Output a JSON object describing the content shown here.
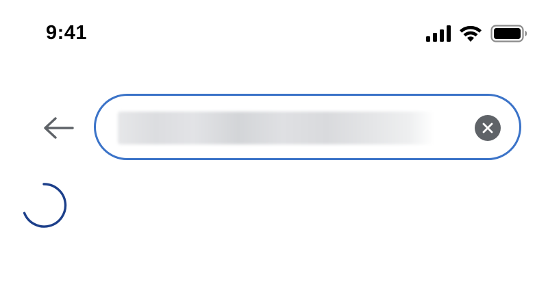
{
  "status_bar": {
    "time": "9:41",
    "icons": [
      "cellular-signal-icon",
      "wifi-icon",
      "battery-icon"
    ]
  },
  "search": {
    "value": "",
    "placeholder": "",
    "back_icon": "arrow-left-icon",
    "clear_icon": "clear-circle-icon",
    "query_obscured": true
  },
  "loading": {
    "icon": "loading-spinner-icon"
  },
  "colors": {
    "background": "#ffffff",
    "search_border": "#3b73c8",
    "clear_button": "#5f6368",
    "back_arrow": "#5f6368",
    "spinner": "#1c3f8a",
    "status_text": "#000000"
  }
}
